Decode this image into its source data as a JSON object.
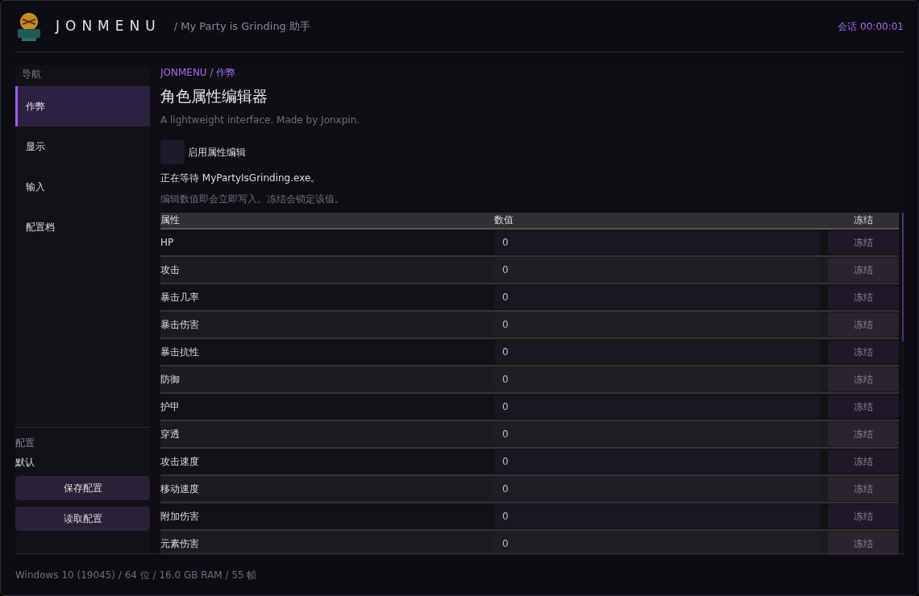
{
  "header": {
    "brand": "JONMENU",
    "subtitle": "/ My Party is Grinding 助手",
    "session": "会话 00:00:01"
  },
  "sidebar": {
    "heading": "导航",
    "items": [
      {
        "label": "作弊",
        "selected": true
      },
      {
        "label": "显示",
        "selected": false
      },
      {
        "label": "输入",
        "selected": false
      },
      {
        "label": "配置档",
        "selected": false
      }
    ],
    "config_heading": "配置",
    "config_name": "默认",
    "buttons": [
      "保存配置",
      "读取配置"
    ]
  },
  "main": {
    "breadcrumb": "JONMENU / 作弊",
    "title": "角色属性编辑器",
    "tagline": "A lightweight interface. Made by Jonxpin.",
    "enable": {
      "label": "启用属性编辑",
      "checked": false
    },
    "status": "正在等待 MyPartyIsGrinding.exe。",
    "hint": "编辑数值即会立即写入。冻结会锁定该值。",
    "table": {
      "columns": [
        "属性",
        "数值",
        "冻结"
      ],
      "rows": [
        {
          "name": "HP",
          "value": "0",
          "button": "冻结"
        },
        {
          "name": "攻击",
          "value": "0",
          "button": "冻结"
        },
        {
          "name": "暴击几率",
          "value": "0",
          "button": "冻结"
        },
        {
          "name": "暴击伤害",
          "value": "0",
          "button": "冻结"
        },
        {
          "name": "暴击抗性",
          "value": "0",
          "button": "冻结"
        },
        {
          "name": "防御",
          "value": "0",
          "button": "冻结"
        },
        {
          "name": "护甲",
          "value": "0",
          "button": "冻结"
        },
        {
          "name": "穿透",
          "value": "0",
          "button": "冻结"
        },
        {
          "name": "攻击速度",
          "value": "0",
          "button": "冻结"
        },
        {
          "name": "移动速度",
          "value": "0",
          "button": "冻结"
        },
        {
          "name": "附加伤害",
          "value": "0",
          "button": "冻结"
        },
        {
          "name": "元素伤害",
          "value": "0",
          "button": "冻结"
        }
      ]
    }
  },
  "status_bar": "Windows 10 (19045) / 64 位 / 16.0 GB RAM / 55 帧"
}
